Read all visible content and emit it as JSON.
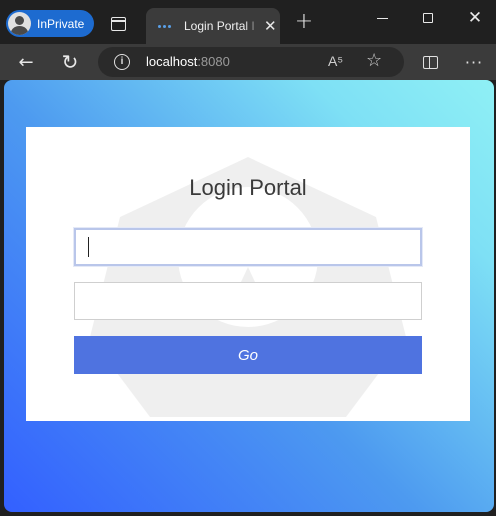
{
  "browser": {
    "profile_label": "InPrivate",
    "tab_title": "Login Portal I",
    "url_host": "localhost",
    "url_port": ":8080",
    "read_aloud_glyph": "A⁵",
    "icons": [
      "profile-avatar-icon",
      "tab-actions-icon",
      "favicon-icon",
      "close-icon",
      "new-tab-icon",
      "minimize-icon",
      "maximize-icon",
      "back-icon",
      "refresh-icon",
      "site-info-icon",
      "read-aloud-icon",
      "favorite-star-icon",
      "split-screen-icon",
      "more-options-icon"
    ]
  },
  "login": {
    "title": "Login Portal",
    "username_value": "",
    "password_value": "",
    "go_label": "Go"
  },
  "colors": {
    "inprivate": "#1d6bd0",
    "button": "#4f73e0",
    "gradient_start": "#3360ff",
    "gradient_end": "#8ff0f5"
  }
}
